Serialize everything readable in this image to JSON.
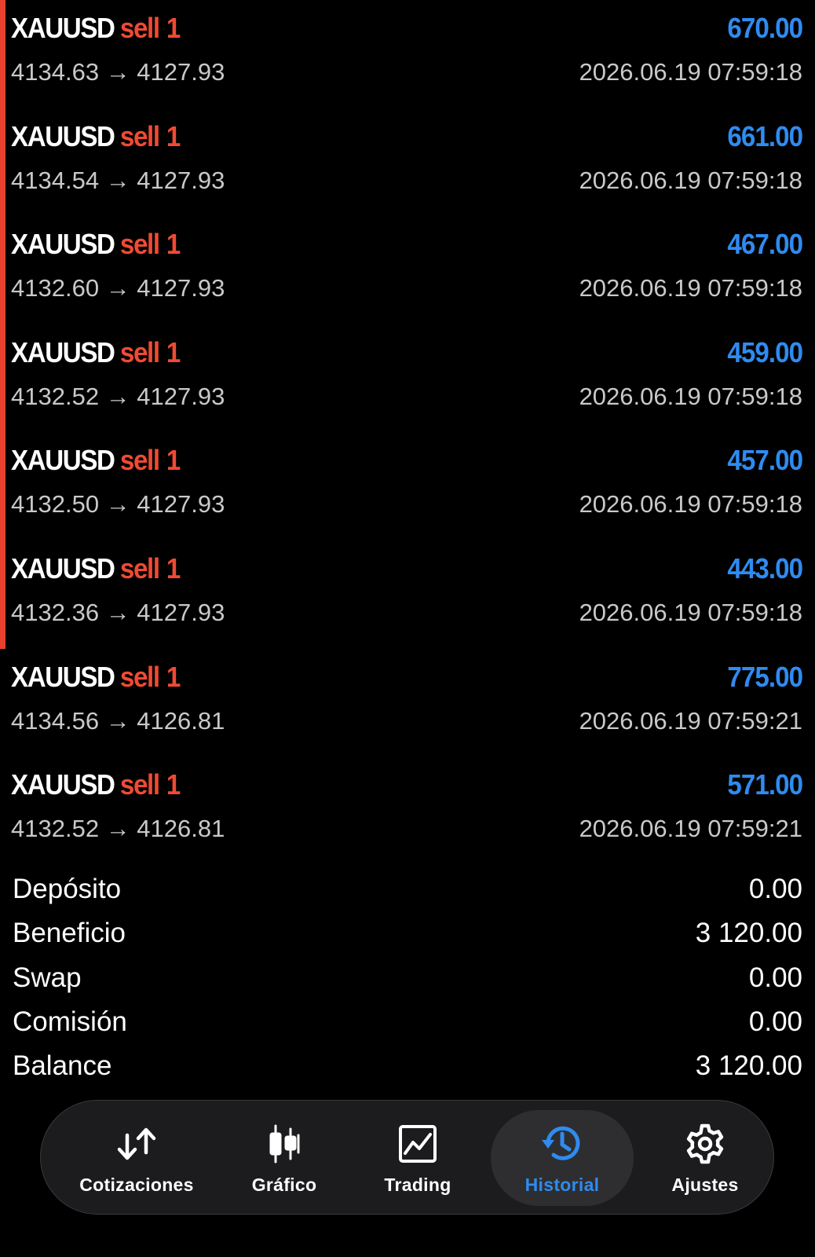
{
  "trades": [
    {
      "symbol": "XAUUSD",
      "type": "sell",
      "volume": "1",
      "prices": "4134.63 → 4127.93",
      "time": "2026.06.19 07:59:18",
      "profit": "670.00",
      "selected": true
    },
    {
      "symbol": "XAUUSD",
      "type": "sell",
      "volume": "1",
      "prices": "4134.54 → 4127.93",
      "time": "2026.06.19 07:59:18",
      "profit": "661.00",
      "selected": true
    },
    {
      "symbol": "XAUUSD",
      "type": "sell",
      "volume": "1",
      "prices": "4132.60 → 4127.93",
      "time": "2026.06.19 07:59:18",
      "profit": "467.00",
      "selected": true
    },
    {
      "symbol": "XAUUSD",
      "type": "sell",
      "volume": "1",
      "prices": "4132.52 → 4127.93",
      "time": "2026.06.19 07:59:18",
      "profit": "459.00",
      "selected": true
    },
    {
      "symbol": "XAUUSD",
      "type": "sell",
      "volume": "1",
      "prices": "4132.50 → 4127.93",
      "time": "2026.06.19 07:59:18",
      "profit": "457.00",
      "selected": true
    },
    {
      "symbol": "XAUUSD",
      "type": "sell",
      "volume": "1",
      "prices": "4132.36 → 4127.93",
      "time": "2026.06.19 07:59:18",
      "profit": "443.00",
      "selected": true
    },
    {
      "symbol": "XAUUSD",
      "type": "sell",
      "volume": "1",
      "prices": "4134.56 → 4126.81",
      "time": "2026.06.19 07:59:21",
      "profit": "775.00",
      "selected": false
    },
    {
      "symbol": "XAUUSD",
      "type": "sell",
      "volume": "1",
      "prices": "4132.52 → 4126.81",
      "time": "2026.06.19 07:59:21",
      "profit": "571.00",
      "selected": false
    }
  ],
  "summary": [
    {
      "label": "Depósito",
      "value": "0.00"
    },
    {
      "label": "Beneficio",
      "value": "3 120.00"
    },
    {
      "label": "Swap",
      "value": "0.00"
    },
    {
      "label": "Comisión",
      "value": "0.00"
    },
    {
      "label": "Balance",
      "value": "3 120.00"
    }
  ],
  "tabs": [
    {
      "label": "Cotizaciones",
      "icon": "quotes-arrows-icon",
      "active": false
    },
    {
      "label": "Gráfico",
      "icon": "candlestick-chart-icon",
      "active": false
    },
    {
      "label": "Trading",
      "icon": "trading-chart-icon",
      "active": false
    },
    {
      "label": "Historial",
      "icon": "history-clock-icon",
      "active": true
    },
    {
      "label": "Ajustes",
      "icon": "gear-icon",
      "active": false
    }
  ],
  "colors": {
    "background": "#000000",
    "sell": "#f04a33",
    "profit": "#2f8bf0",
    "selection_bar": "#e8402f",
    "active_tab": "#2f8bf0"
  }
}
